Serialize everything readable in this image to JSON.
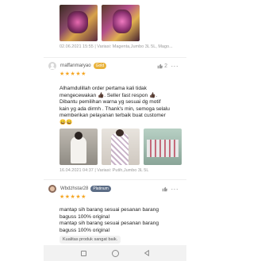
{
  "reviews": [
    {
      "photo_meta": "02.06.2021 15:55 | Variasi: Magenta,Jumbo 3L 5L, Mago..."
    },
    {
      "username": "rnaffanmaryao",
      "badge": "Gold",
      "likes": "2",
      "stars": "★★★★★",
      "lines": [
        "Alhamdulillah order pertama kali tidak",
        "mengecewakan 👍🏿. Seller fast respon 👍🏿.",
        "Dibantu pemilihan warna yg sesuai dg motif",
        "kain yg ada dirmh . Thank's min, semoga selalu",
        "memberikan pelayanan terbaik buat customer",
        "😀😀"
      ],
      "meta": "16.04.2021 04:37 | Variasi: Putih,Jumbo 3L 5L"
    },
    {
      "username": "Wbdzhstar28",
      "badge": "Platinum",
      "stars": "★★★★★",
      "lines": [
        "mantap sih barang sesuai pesanan barang",
        "baguss 100% original",
        "mantap sih barang sesuai pesanan barang",
        "baguss 100% original"
      ],
      "tag": "Kualitas produk sangat baik."
    }
  ],
  "colors": {
    "star": "#f5a623",
    "gold_badge": "#e9b23a",
    "platinum_badge": "#5c6d86"
  },
  "icons": {
    "like": "thumbs-up-icon",
    "more": "more-dots-icon",
    "nav": [
      "recent-apps-icon",
      "home-icon",
      "back-icon"
    ]
  }
}
